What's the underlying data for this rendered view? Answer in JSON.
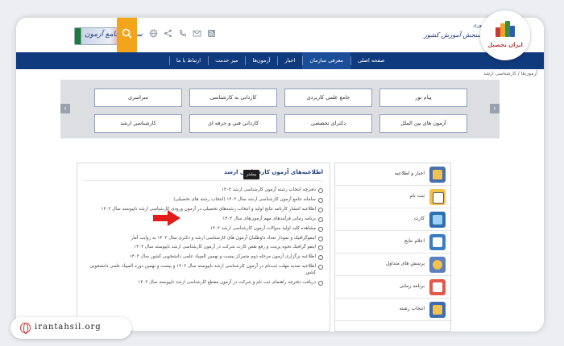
{
  "header": {
    "site_logo_text": "سامانه جامع آزمون",
    "org_small": "ریاست جمهوری",
    "org_name": "سازمان سنجش آموزش کشور",
    "icons": [
      "search-icon",
      "globe-icon",
      "share-icon",
      "phone-icon",
      "mail-icon",
      "rss-icon"
    ]
  },
  "nav": {
    "items": [
      "صفحه اصلی",
      "معرفی سازمان",
      "اخبار",
      "آزمون‌ها",
      "میز خدمت",
      "ارتباط با ما"
    ]
  },
  "breadcrumb": "آزمون‌ها / کارشناسی ارشد",
  "categories": {
    "row1": [
      "پیام نور",
      "جامع علمی کاربردی",
      "کاردانی به کارشناسی",
      "سراسری"
    ],
    "row2": [
      "آزمون های بین الملل",
      "دکترای تخصصی",
      "کاردانی فنی و حرفه ای",
      "کارشناسی ارشد"
    ],
    "prev_icon": "chevron-left-icon",
    "next_icon": "chevron-right-icon"
  },
  "announcements": {
    "title": "اطلاعیه‌های آزمون کارشناسی ارشد",
    "items": [
      "دفترچه انتخاب رشته آزمون کارشناسی ارشد ۱۴۰۳",
      "سامانه جامع آزمون کارشناسی ارشد سال ۱۴۰۳ (انتخاب رشته های تحصیلی)",
      "اطلاعیه انتشار کارنامه نتایج اولیه و انتخاب رشته‌های تحصیلی در آزمون ورودی کارشناسی ارشد ناپیوسته سال ۱۴۰۳",
      "برنامه زمانی فرآیندهای مهم آزمون‌های سال ۱۴۰۳",
      "مشاهده کلید اولیه سوالات آزمون کارشناسی ارشد ۱۴۰۳",
      "اینفوگرافیک و نمودار تعداد داوطلبان آزمون های کارشناسی ارشد و دکتری سال ۱۴۰۳ به روایت آمار",
      "اینفو گرافیک نحوه پرینت و رفع نقص کارت شرکت در آزمون کارشناسی ارشد ناپیوسته سال ۱۴۰۳",
      "اطلاعیه برگزاری آزمون مرحله دوم متمرکز بیست و نهمین المپیاد علمی دانشجویی کشور سال ۱۴۰۳",
      "اطلاعیه تمدید مهلت ثبت‌نام در آزمون کارشناسی ارشد ناپیوسته سال ۱۴۰۳ و بیست و نهمین دوره المپیاد علمی دانشجویی کشور",
      "دریافت دفترچه راهنمای ثبت نام و شرکت در آزمون مقطع کارشناسی ارشد ناپیوسته سال ۱۴۰۳"
    ],
    "more_label": "بیشتر"
  },
  "sidebar": {
    "items": [
      {
        "label": "اخبار و اطلاعیه",
        "icon": "news-icon"
      },
      {
        "label": "ثبت نام",
        "icon": "registration-icon"
      },
      {
        "label": "کارت",
        "icon": "card-icon"
      },
      {
        "label": "اعلام نتایج",
        "icon": "results-icon"
      },
      {
        "label": "پرسش های متداول",
        "icon": "faq-icon"
      },
      {
        "label": "برنامه زمانی",
        "icon": "calendar-icon"
      },
      {
        "label": "انتخاب رشته",
        "icon": "selection-icon"
      }
    ]
  },
  "brand": {
    "name": "ایران تحصیل",
    "url": "irantahsil.org"
  },
  "colors": {
    "nav": "#0f3a7d",
    "search_tile": "#f4a41b",
    "brand_red": "#c23a3a",
    "arrow_red": "#e31b1b"
  }
}
